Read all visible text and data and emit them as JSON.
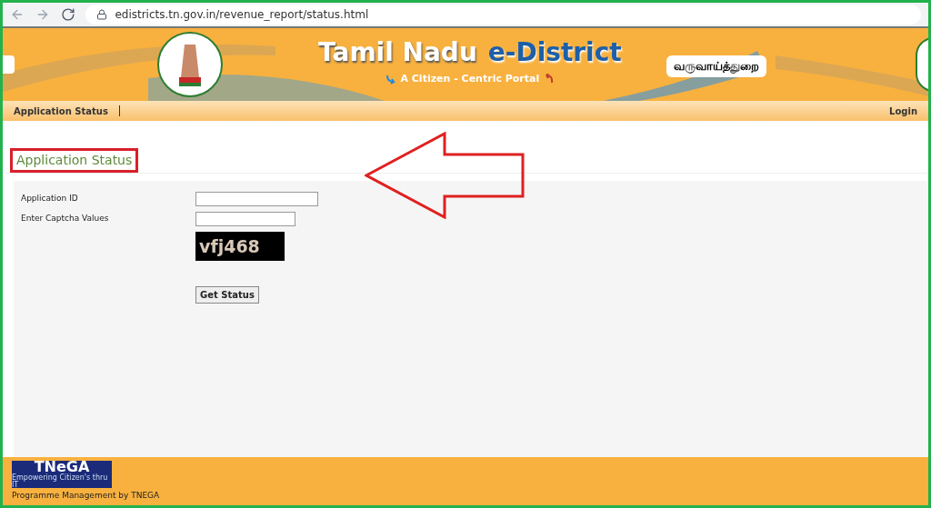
{
  "browser": {
    "url": "edistricts.tn.gov.in/revenue_report/status.html"
  },
  "header": {
    "title_main": "Tamil Nadu",
    "title_accent": "e-District",
    "tagline": "A Citizen - Centric Portal",
    "department": "வருவாய்த்துறை"
  },
  "nav": {
    "items": [
      "Application Status"
    ],
    "login": "Login"
  },
  "form": {
    "heading": "Application Status",
    "fields": [
      {
        "label": "Application ID",
        "kind": "wide"
      },
      {
        "label": "Enter Captcha Values",
        "kind": "narrow"
      }
    ],
    "captcha": "vfj468",
    "button": "Get Status"
  },
  "footer": {
    "logo_title": "TNeGA",
    "logo_subtitle": "Empowering Citizen's thru IT",
    "credit": "Programme Management by TNEGA"
  }
}
